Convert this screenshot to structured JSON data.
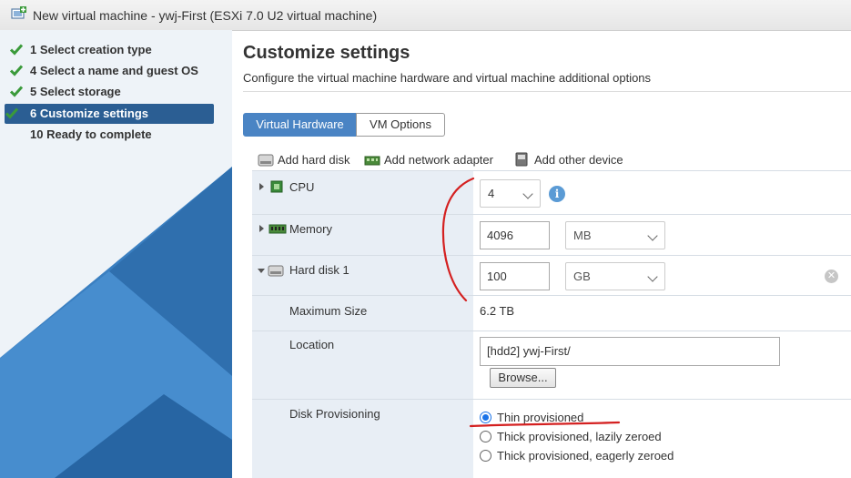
{
  "window": {
    "title": "New virtual machine - ywj-First (ESXi 7.0 U2 virtual machine)"
  },
  "steps": [
    {
      "label": "1  Select creation type",
      "done": true
    },
    {
      "label": "4  Select a name and guest OS",
      "done": true
    },
    {
      "label": "5  Select storage",
      "done": true
    },
    {
      "label": "6  Customize settings",
      "done": true,
      "active": true
    },
    {
      "label": "10  Ready to complete",
      "done": false
    }
  ],
  "main": {
    "title": "Customize settings",
    "subtitle": "Configure the virtual machine hardware and virtual machine additional options",
    "tabs": [
      {
        "label": "Virtual Hardware",
        "selected": true
      },
      {
        "label": "VM Options",
        "selected": false
      }
    ],
    "toolbar": {
      "add_hard_disk": "Add hard disk",
      "add_network_adapter": "Add network adapter",
      "add_other_device": "Add other device"
    }
  },
  "hardware": {
    "cpu": {
      "label": "CPU",
      "value": "4"
    },
    "memory": {
      "label": "Memory",
      "value": "4096",
      "unit": "MB"
    },
    "hard_disk": {
      "label": "Hard disk 1",
      "value": "100",
      "unit": "GB",
      "max_size_label": "Maximum Size",
      "max_size_value": "6.2 TB",
      "location_label": "Location",
      "location_value": "[hdd2] ywj-First/",
      "browse_label": "Browse...",
      "provisioning_label": "Disk Provisioning",
      "provisioning_options": [
        {
          "label": "Thin provisioned",
          "selected": true
        },
        {
          "label": "Thick provisioned, lazily zeroed",
          "selected": false
        },
        {
          "label": "Thick provisioned, eagerly zeroed",
          "selected": false
        }
      ]
    }
  },
  "colors": {
    "accent": "#2b5e93",
    "tab_selected": "#4a84c4",
    "check": "#3a9a3a",
    "annotation": "#d42020"
  },
  "icons": [
    "vm-icon",
    "check-icon",
    "hard-disk-icon",
    "network-adapter-icon",
    "other-device-icon",
    "cpu-icon",
    "memory-icon",
    "info-icon",
    "remove-icon",
    "chevron-down-icon",
    "expand-arrow-icon"
  ]
}
